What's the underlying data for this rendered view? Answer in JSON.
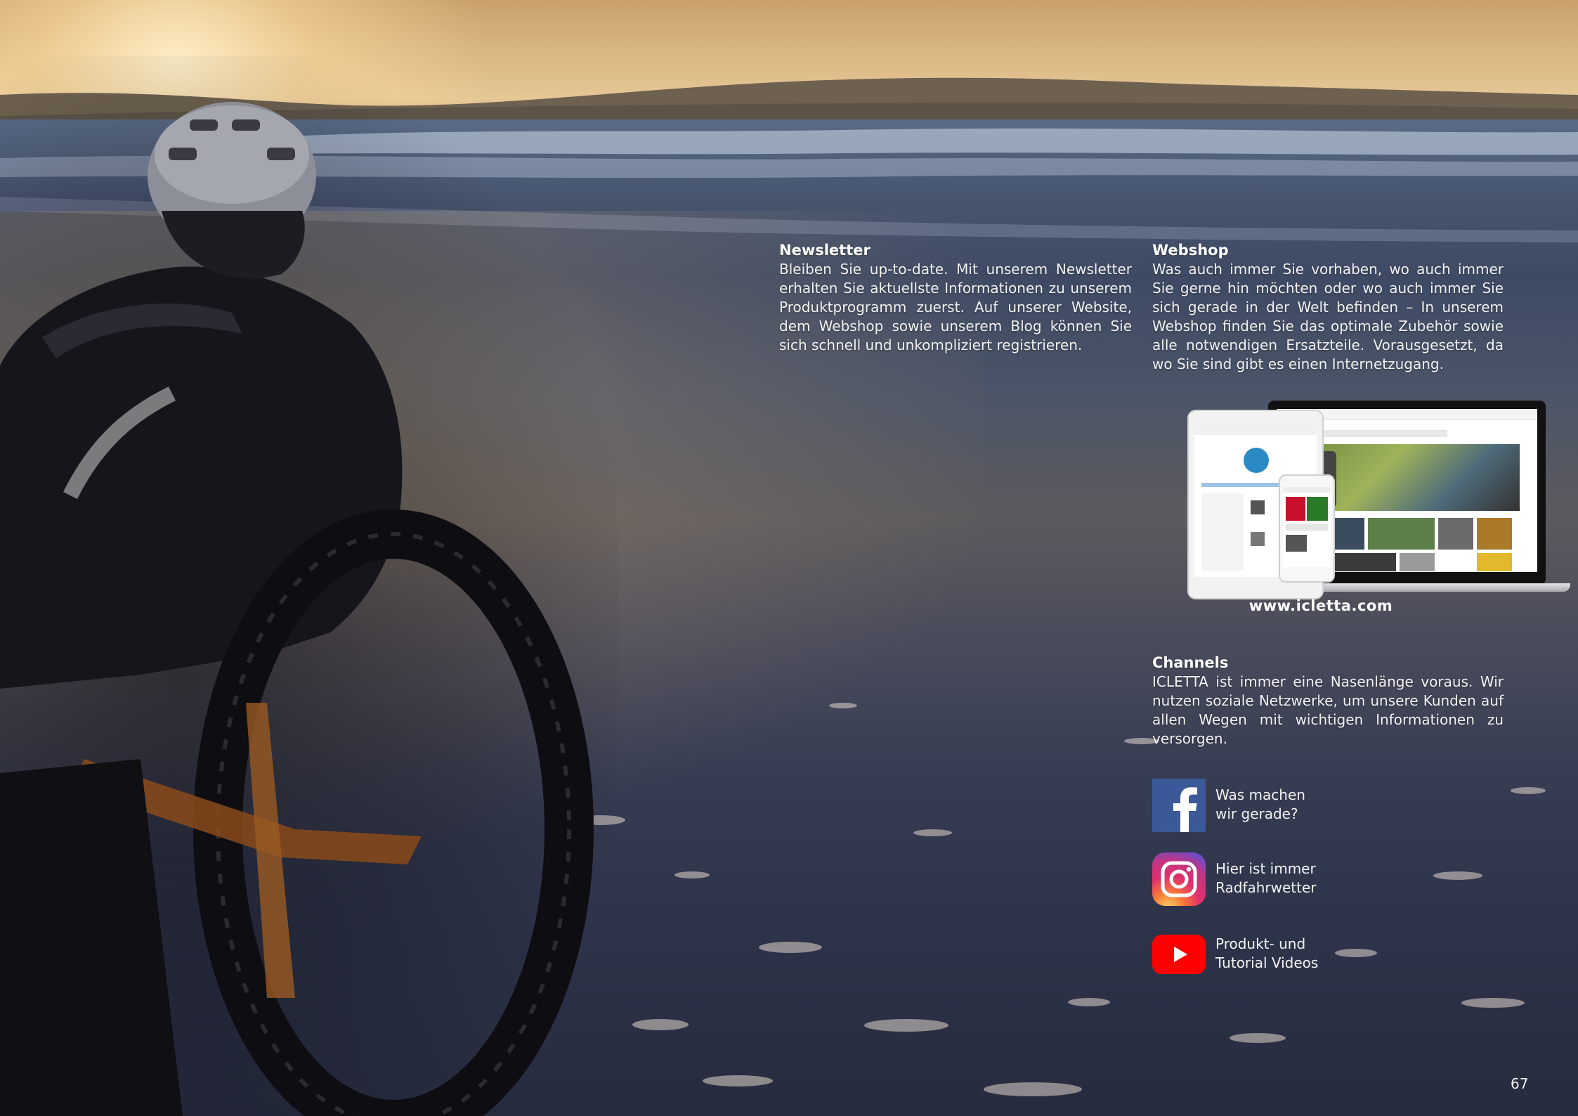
{
  "newsletter": {
    "heading": "Newsletter",
    "body": "Bleiben Sie up-to-date. Mit unserem Newsletter erhalten Sie aktuellste Informationen zu unserem Produktprogramm zuerst. Auf unserer Website, dem Webshop sowie unserem Blog können Sie sich schnell und unkompliziert registrieren."
  },
  "webshop": {
    "heading": "Webshop",
    "body": "Was auch immer Sie vorhaben, wo auch immer Sie gerne hin möchten oder wo auch immer Sie sich gerade in der Welt befinden – In unserem Webshop finden Sie das optimale Zubehör sowie alle notwendigen Ersatzteile. Vorausgesetzt, da wo Sie sind gibt es einen Internetzugang.",
    "url": "www.icletta.com"
  },
  "channels": {
    "heading": "Channels",
    "body": "ICLETTA ist immer eine Nasenlänge voraus. Wir nutzen soziale Netzwerke, um unsere Kunden auf allen Wegen mit wichtigen Informationen zu versorgen.",
    "items": [
      {
        "icon": "facebook-icon",
        "label": "Was machen\nwir gerade?",
        "color": "#3b5998"
      },
      {
        "icon": "instagram-icon",
        "label": "Hier ist immer\nRadfahrwetter",
        "color": "#c13584"
      },
      {
        "icon": "youtube-icon",
        "label": "Produkt- und\nTutorial Videos",
        "color": "#ff0000"
      }
    ]
  },
  "page_number": "67"
}
